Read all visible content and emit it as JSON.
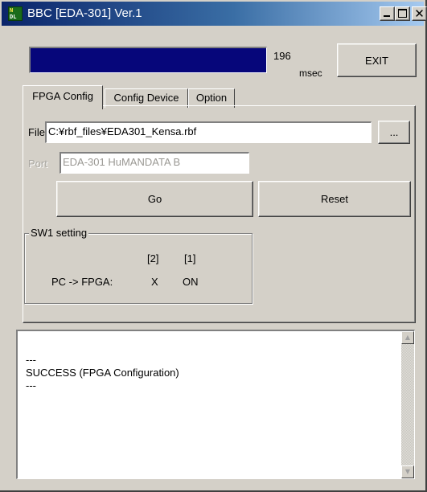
{
  "window": {
    "title": "BBC [EDA-301] Ver.1",
    "icon_text_top": "N",
    "icon_text_bottom": "DL",
    "controls": {
      "minimize": "minimize-icon",
      "maximize": "maximize-icon",
      "close": "✕"
    }
  },
  "status": {
    "progress_fraction": 1.0,
    "progress_color": "#06067a",
    "elapsed_value": "196",
    "elapsed_unit": "msec"
  },
  "exit_label": "EXIT",
  "tabs": [
    {
      "label": "FPGA Config",
      "active": true
    },
    {
      "label": "Config Device",
      "active": false
    },
    {
      "label": "Option",
      "active": false
    }
  ],
  "fpga_config": {
    "file_label": "File",
    "file_value": "C:¥rbf_files¥EDA301_Kensa.rbf",
    "browse_label": "...",
    "port_label": "Port",
    "port_value": "EDA-301 HuMANDATA B",
    "go_label": "Go",
    "reset_label": "Reset",
    "sw1": {
      "title": "SW1 setting",
      "col2_header": "[2]",
      "col1_header": "[1]",
      "row_label": "PC -> FPGA:",
      "col2_value": "X",
      "col1_value": "ON"
    }
  },
  "log": {
    "line1": "---",
    "line2": "SUCCESS (FPGA Configuration)",
    "line3": "---"
  }
}
